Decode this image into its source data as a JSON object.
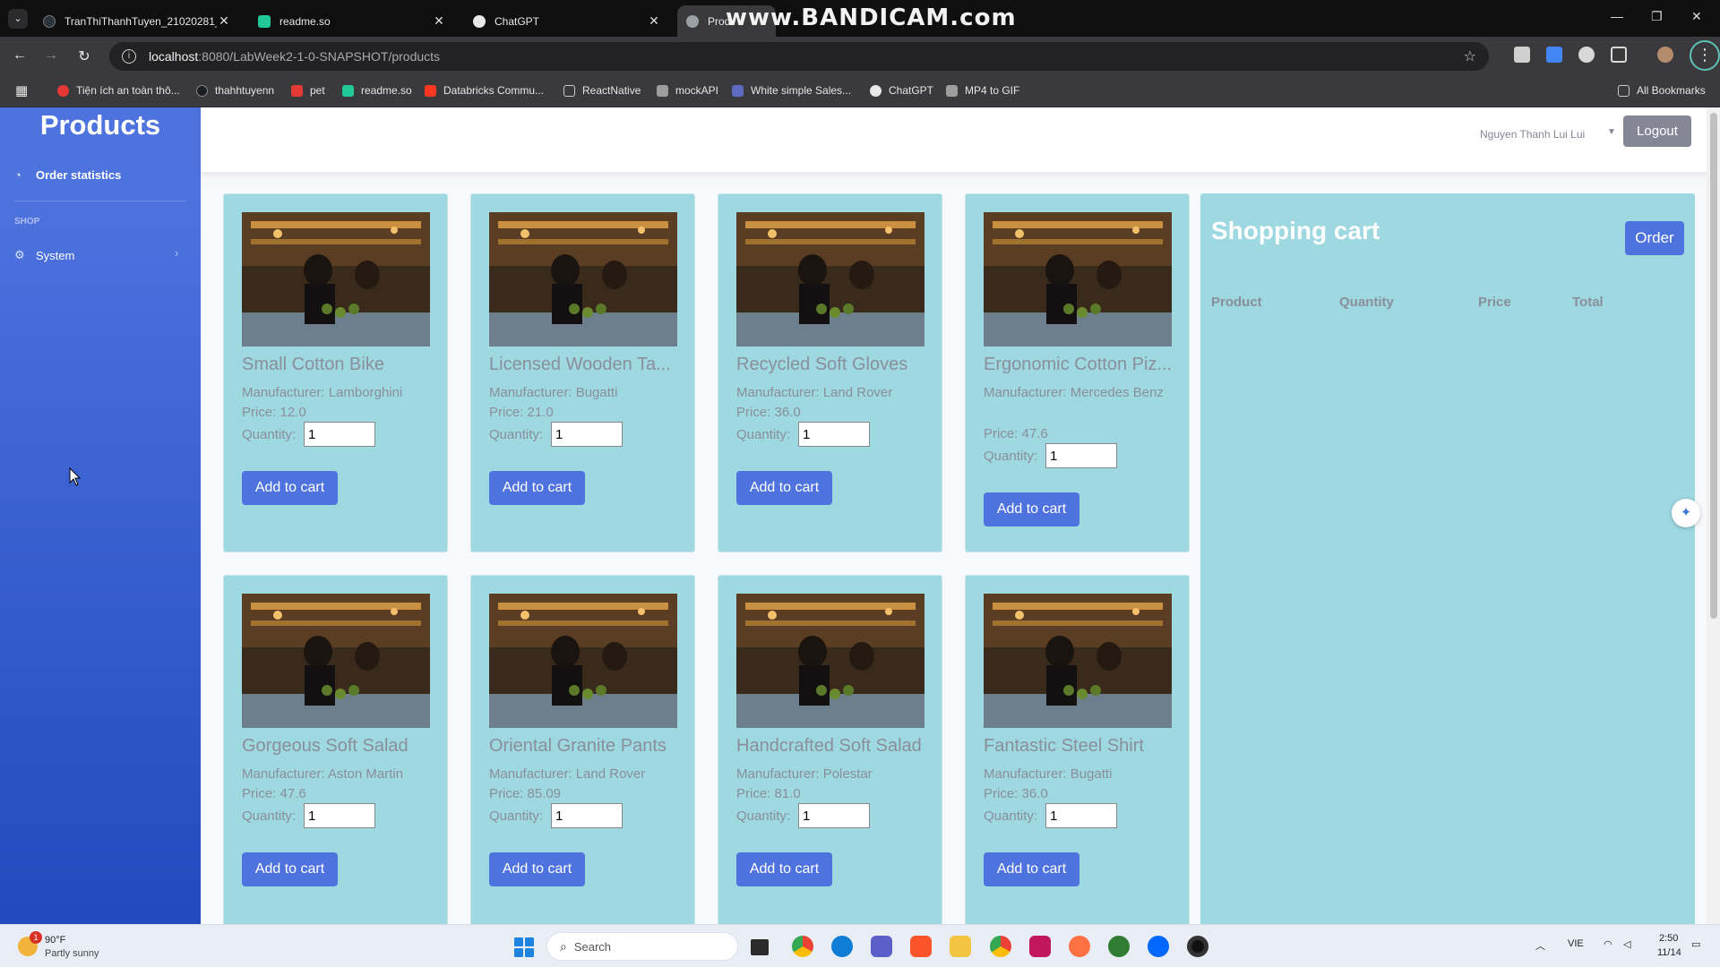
{
  "browser": {
    "tabs": [
      {
        "title": "TranThiThanhTuyen_21020281_",
        "close": "✕",
        "color": "#1b1f23"
      },
      {
        "title": "readme.so",
        "close": "✕",
        "color": "#20c997"
      },
      {
        "title": "ChatGPT",
        "close": "✕",
        "color": "#e8e8e8"
      },
      {
        "title": "Prod",
        "close": "",
        "color": "#9aa0a6"
      }
    ],
    "watermark": "www.BANDICAM.com",
    "url_host": "localhost",
    "url_path": ":8080/LabWeek2-1-0-SNAPSHOT/products",
    "bookmarks": [
      {
        "label": "Tiện ích an toàn thô...",
        "color": "#e53935"
      },
      {
        "label": "thahhtuyenn",
        "color": "#1b1f23"
      },
      {
        "label": "pet",
        "color": "#e53935"
      },
      {
        "label": "readme.so",
        "color": "#20c997"
      },
      {
        "label": "Databricks Commu...",
        "color": "#ff3621"
      },
      {
        "label": "ReactNative",
        "color": "#c9c9c9"
      },
      {
        "label": "mockAPI",
        "color": "#9e9e9e"
      },
      {
        "label": "White simple Sales...",
        "color": "#5c6bc0"
      },
      {
        "label": "ChatGPT",
        "color": "#e8e8e8"
      },
      {
        "label": "MP4 to GIF",
        "color": "#9e9e9e"
      }
    ],
    "all_bookmarks": "All Bookmarks"
  },
  "sidebar": {
    "brand": "Products",
    "items": [
      {
        "label": "Order statistics",
        "icon": "tachometer-icon"
      },
      {
        "label": "System",
        "icon": "gear-icon"
      }
    ],
    "heading": "SHOP"
  },
  "topbar": {
    "user": "Nguyen Thanh Lui Lui",
    "logout": "Logout"
  },
  "products": [
    {
      "name": "Small Cotton Bike",
      "manufacturer": "Manufacturer: Lamborghini",
      "price": "Price: 12.0",
      "qty_label": "Quantity:",
      "qty": "1",
      "button": "Add to cart"
    },
    {
      "name": "Licensed Wooden Ta...",
      "manufacturer": "Manufacturer: Bugatti",
      "price": "Price: 21.0",
      "qty_label": "Quantity:",
      "qty": "1",
      "button": "Add to cart"
    },
    {
      "name": "Recycled Soft Gloves",
      "manufacturer": "Manufacturer: Land Rover",
      "price": "Price: 36.0",
      "qty_label": "Quantity:",
      "qty": "1",
      "button": "Add to cart"
    },
    {
      "name": "Ergonomic Cotton Piz...",
      "manufacturer": "Manufacturer: Mercedes Benz",
      "price": "Price: 47.6",
      "qty_label": "Quantity:",
      "qty": "1",
      "button": "Add to cart"
    },
    {
      "name": "Gorgeous Soft Salad",
      "manufacturer": "Manufacturer: Aston Martin",
      "price": "Price: 47.6",
      "qty_label": "Quantity:",
      "qty": "1",
      "button": "Add to cart"
    },
    {
      "name": "Oriental Granite Pants",
      "manufacturer": "Manufacturer: Land Rover",
      "price": "Price: 85.09",
      "qty_label": "Quantity:",
      "qty": "1",
      "button": "Add to cart"
    },
    {
      "name": "Handcrafted Soft Salad",
      "manufacturer": "Manufacturer: Polestar",
      "price": "Price: 81.0",
      "qty_label": "Quantity:",
      "qty": "1",
      "button": "Add to cart"
    },
    {
      "name": "Fantastic Steel Shirt",
      "manufacturer": "Manufacturer: Bugatti",
      "price": "Price: 36.0",
      "qty_label": "Quantity:",
      "qty": "1",
      "button": "Add to cart"
    }
  ],
  "cart": {
    "title": "Shopping cart",
    "order_button": "Order",
    "columns": [
      "Product",
      "Quantity",
      "Price",
      "Total"
    ]
  },
  "taskbar": {
    "temp": "90°F",
    "weather": "Partly sunny",
    "weather_badge": "1",
    "search": "Search",
    "lang": "VIE",
    "time": "2:50",
    "date": "11/14"
  },
  "colors": {
    "sidebar_top": "#4e73df",
    "sidebar_bottom": "#224abe",
    "card_bg": "#9ed8e0",
    "primary_button": "#4e73df",
    "logout_button": "#858796"
  }
}
